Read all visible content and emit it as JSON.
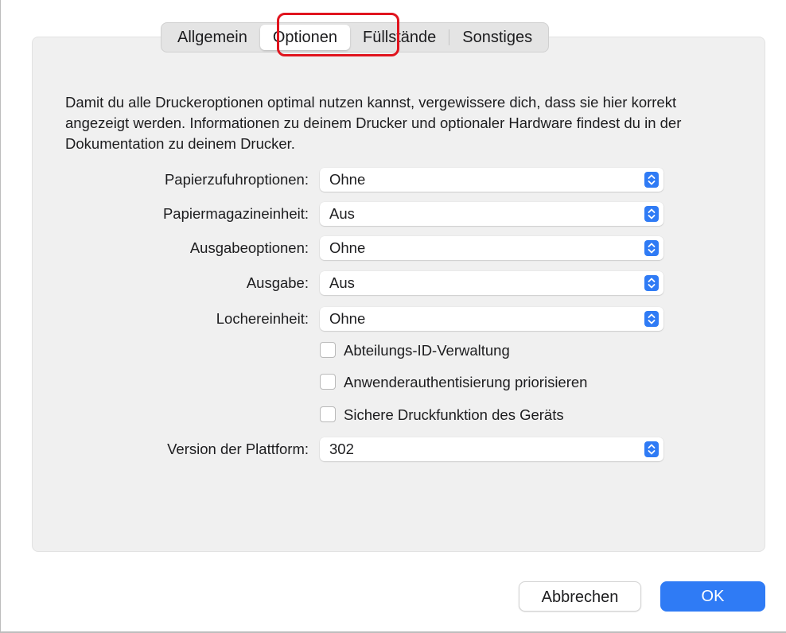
{
  "tabs": [
    {
      "label": "Allgemein"
    },
    {
      "label": "Optionen",
      "active": true
    },
    {
      "label": "Füllstände"
    },
    {
      "label": "Sonstiges"
    }
  ],
  "description": "Damit du alle Druckeroptionen optimal nutzen kannst, vergewissere dich, dass sie hier korrekt angezeigt werden. Informationen zu deinem Drucker und optionaler Hardware findest du in der Dokumentation zu deinem Drucker.",
  "options": [
    {
      "label": "Papierzufuhroptionen:",
      "value": "Ohne"
    },
    {
      "label": "Papiermagazineinheit:",
      "value": "Aus"
    },
    {
      "label": "Ausgabeoptionen:",
      "value": "Ohne"
    },
    {
      "label": "Ausgabe:",
      "value": "Aus"
    },
    {
      "label": "Lochereinheit:",
      "value": "Ohne"
    }
  ],
  "checkboxes": [
    {
      "label": "Abteilungs-ID-Verwaltung",
      "checked": false
    },
    {
      "label": "Anwenderauthentisierung priorisieren",
      "checked": false
    },
    {
      "label": "Sichere Druckfunktion des Geräts",
      "checked": false
    }
  ],
  "platform": {
    "label": "Version der Plattform:",
    "value": "302"
  },
  "buttons": {
    "cancel": "Abbrechen",
    "ok": "OK"
  },
  "colors": {
    "accent": "#2f7bf5",
    "highlight": "#e0141e"
  }
}
